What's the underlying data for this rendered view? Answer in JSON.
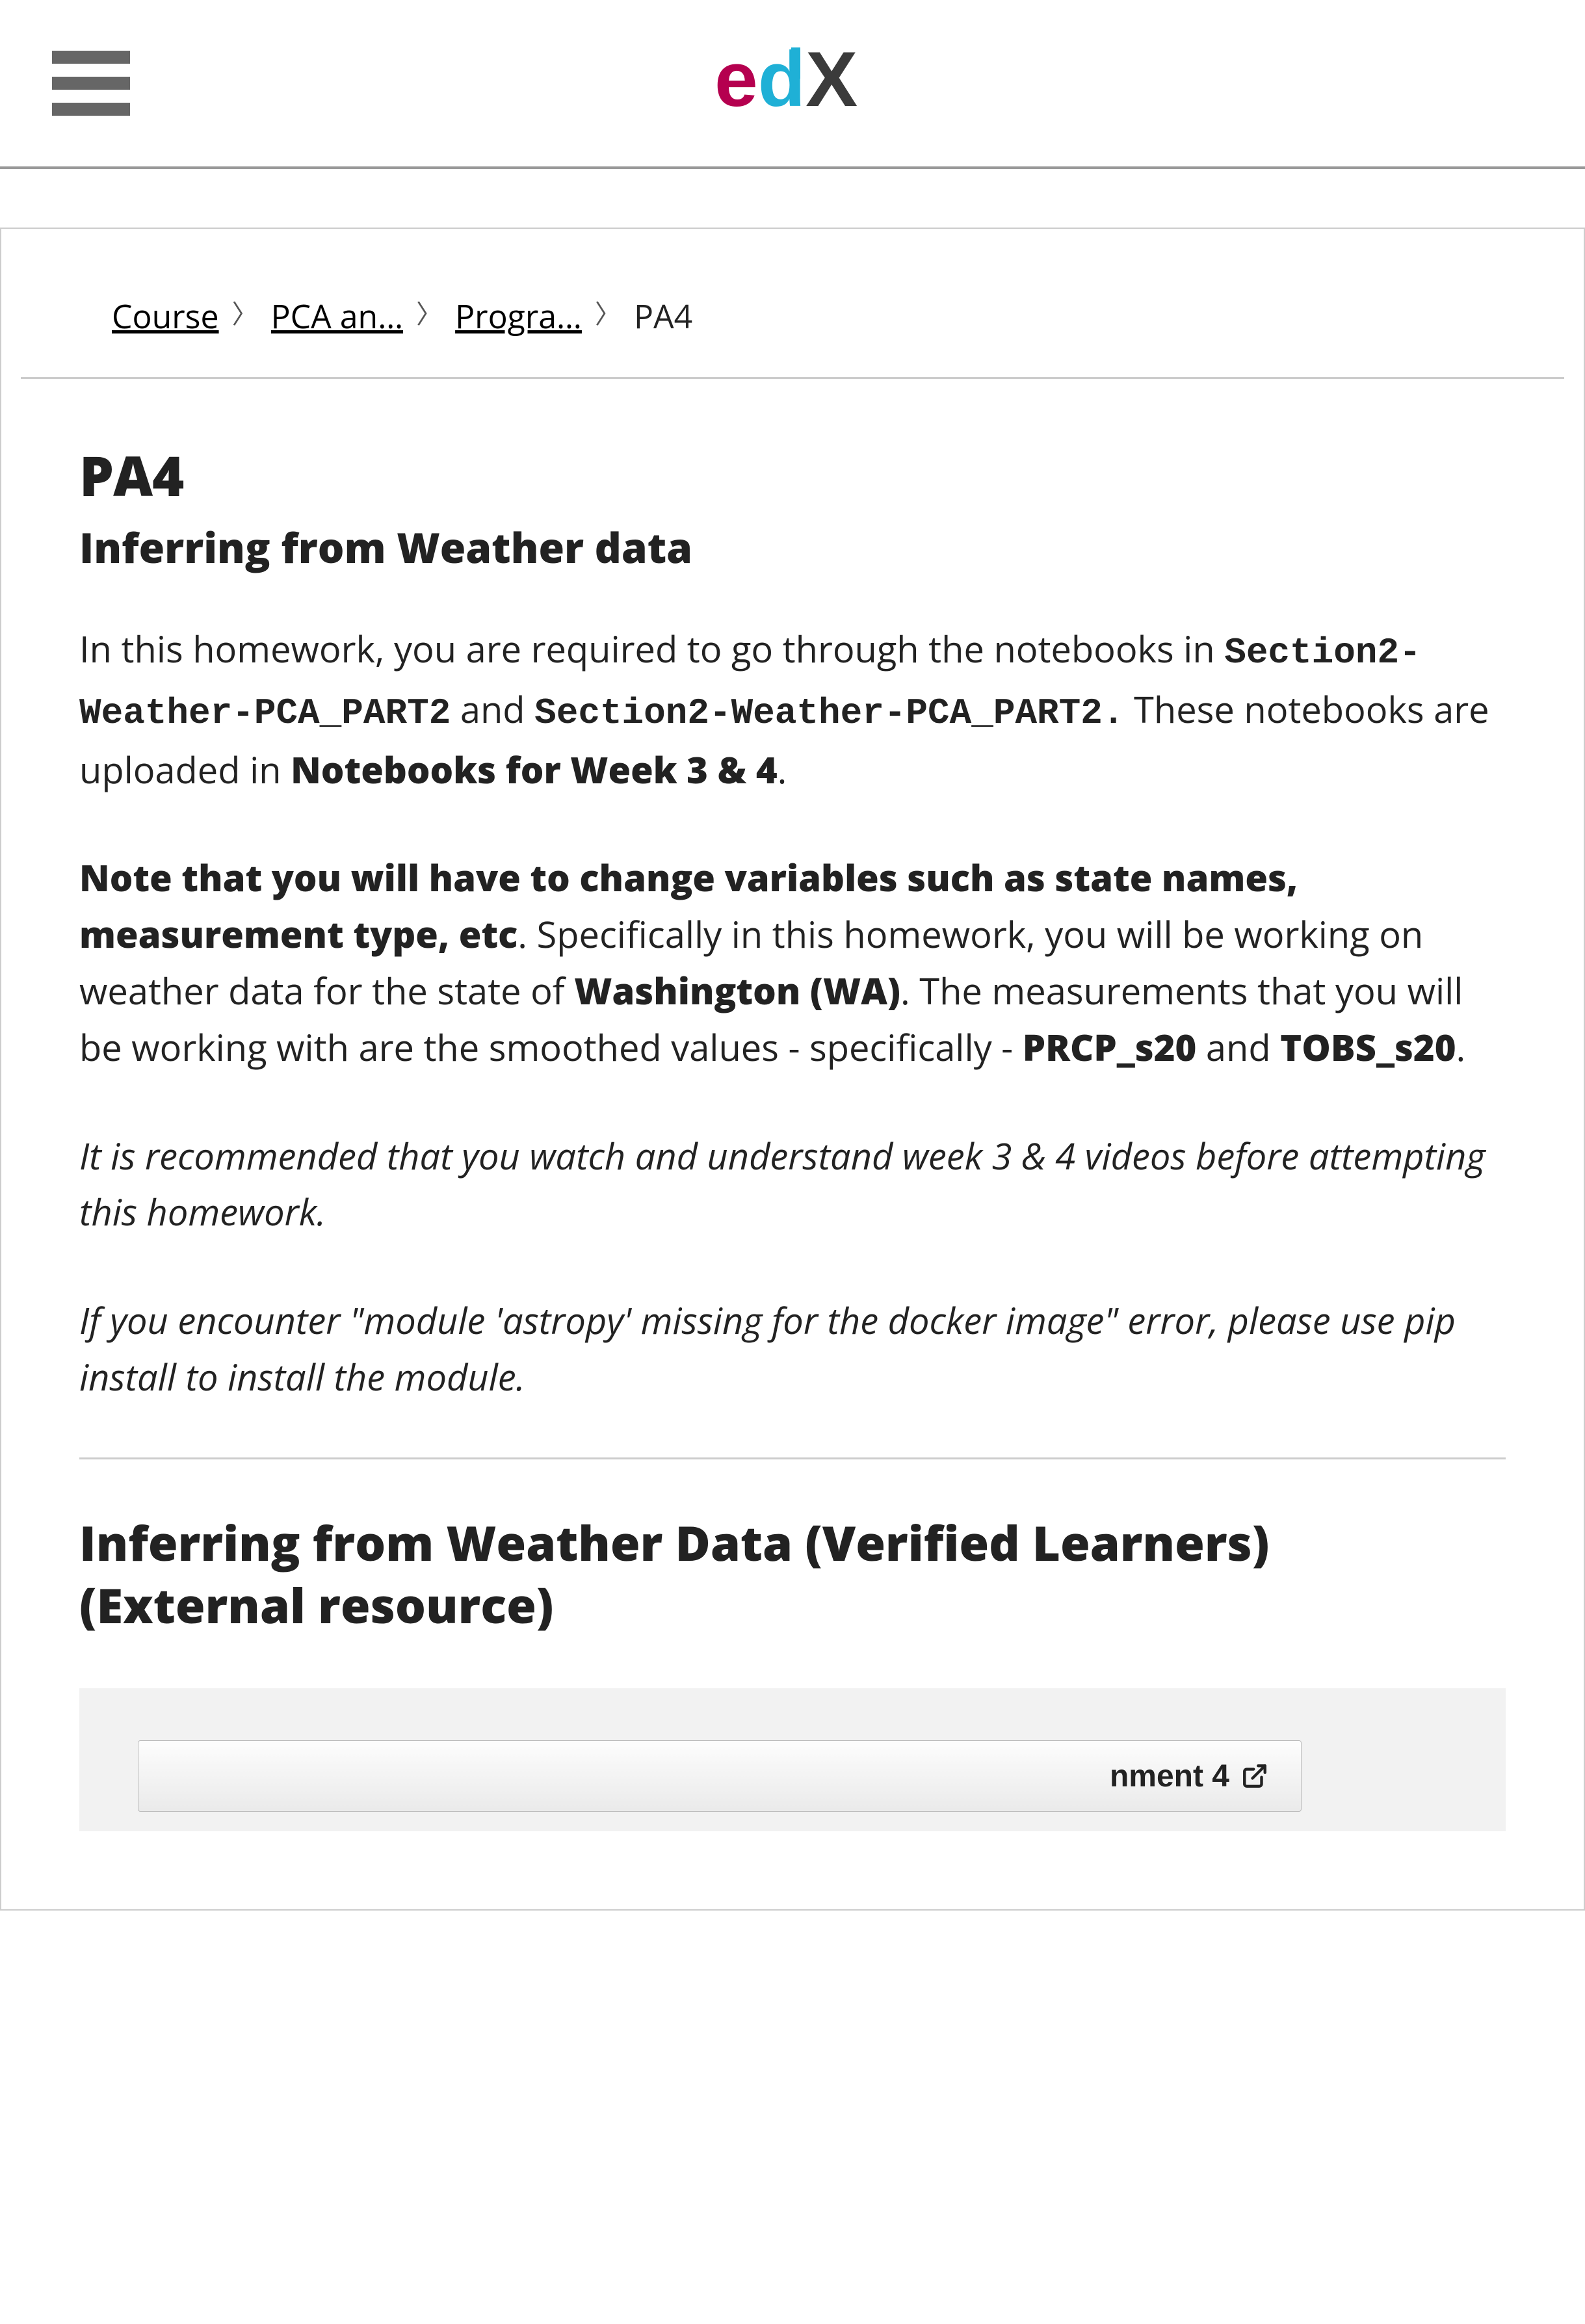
{
  "breadcrumb": {
    "items": [
      {
        "label": "Course"
      },
      {
        "label": "PCA an…"
      },
      {
        "label": "Progra…"
      }
    ],
    "current": "PA4"
  },
  "page": {
    "h1": "PA4",
    "subtitle": "Inferring from Weather data",
    "para1": {
      "t1": "In this homework, you are required to go through the notebooks in ",
      "code1": "Section2-Weather-PCA_PART2",
      "t2": " and ",
      "code2": "Section2-Weather-PCA_PART2.",
      "t3": " These notebooks are uploaded in ",
      "bold1": "Notebooks for Week 3 & 4",
      "t4": "."
    },
    "para2": {
      "bold1": "Note that you will have to change variables such as state names, measurement type, etc",
      "t1": ". Specifically in this homework, you will be working on weather data for the state of ",
      "bold2": "Washington (WA)",
      "t2": ". The measurements that you will be working with are the smoothed values - specifically - ",
      "bold3": "PRCP_s20",
      "t3": " and ",
      "bold4": "TOBS_s20",
      "t4": "."
    },
    "para3": "It is recommended that you watch and understand week 3 & 4 videos before attempting this homework.",
    "para4": "If you encounter \"module 'astropy' missing for the docker image\" error, please use pip install to install the module.",
    "external_title": "Inferring from Weather Data (Verified Learners) (External resource)",
    "lti_button_label": "nment 4"
  }
}
